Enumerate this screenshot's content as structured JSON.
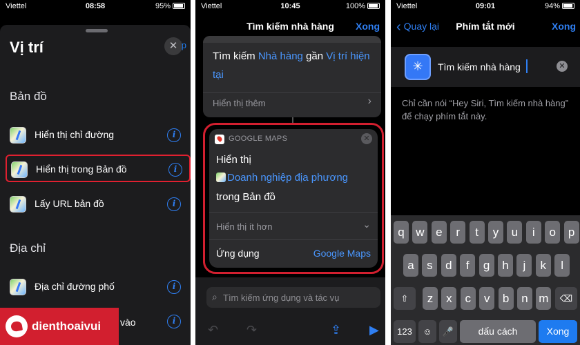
{
  "phone1": {
    "status": {
      "carrier": "Viettel",
      "time": "08:58",
      "battery": "95%"
    },
    "corner_link": "Tiếp",
    "title": "Vị trí",
    "close_symbol": "✕",
    "sections": {
      "maps": "Bản đồ",
      "address": "Địa chỉ"
    },
    "rows": {
      "directions": "Hiển thị chỉ đường",
      "show_in_maps": "Hiển thị trong Bản đồ",
      "get_map_url": "Lấy URL bản đồ",
      "street_address": "Địa chỉ đường phố"
    },
    "tail_label": "vào",
    "info_symbol": "i",
    "highlight_color": "#e02030"
  },
  "logo": {
    "brand": "dienthoaivui",
    "color": "#d21f2f"
  },
  "phone2": {
    "status": {
      "carrier": "Viettel",
      "time": "10:45",
      "battery": "100%"
    },
    "nav_title": "Tìm kiếm nhà hàng",
    "nav_done": "Xong",
    "card1": {
      "w_search": "Tìm kiếm",
      "w_restaurant": "Nhà hàng",
      "w_near": "gần",
      "w_current_location": "Vị trí hiện tại",
      "show_more": "Hiển thị thêm",
      "chevron": "›"
    },
    "card2": {
      "app_label": "GOOGLE MAPS",
      "line1": "Hiển thị",
      "line2": "Doanh nghiệp địa phương",
      "line3": "trong Bản đồ",
      "show_less": "Hiển thị ít hơn",
      "chevron": "⌄",
      "app_row_label": "Ứng dụng",
      "app_row_value": "Google Maps",
      "close": "✕"
    },
    "search_placeholder": "Tìm kiếm ứng dụng và tác vụ",
    "toolbar": {
      "undo": "↶",
      "redo": "↷",
      "share": "⇪",
      "play": "▶"
    },
    "accent": "#2f7ff2"
  },
  "phone3": {
    "status": {
      "carrier": "Viettel",
      "time": "09:01",
      "battery": "94%"
    },
    "back": "Quay lại",
    "nav_title": "Phím tắt mới",
    "nav_done": "Xong",
    "shortcut_name": "Tìm kiếm nhà hàng",
    "clear": "✕",
    "hint": "Chỉ cần nói “Hey Siri, Tìm kiếm nhà hàng” để chạy phím tắt này.",
    "keyboard": {
      "row1": [
        "q",
        "w",
        "e",
        "r",
        "t",
        "y",
        "u",
        "i",
        "o",
        "p"
      ],
      "row2": [
        "a",
        "s",
        "d",
        "f",
        "g",
        "h",
        "j",
        "k",
        "l"
      ],
      "row3": [
        "z",
        "x",
        "c",
        "v",
        "b",
        "n",
        "m"
      ],
      "shift": "⇧",
      "backspace": "⌫",
      "numbers": "123",
      "emoji": "☺",
      "mic": "🎤",
      "space": "dấu cách",
      "done": "Xong"
    }
  }
}
